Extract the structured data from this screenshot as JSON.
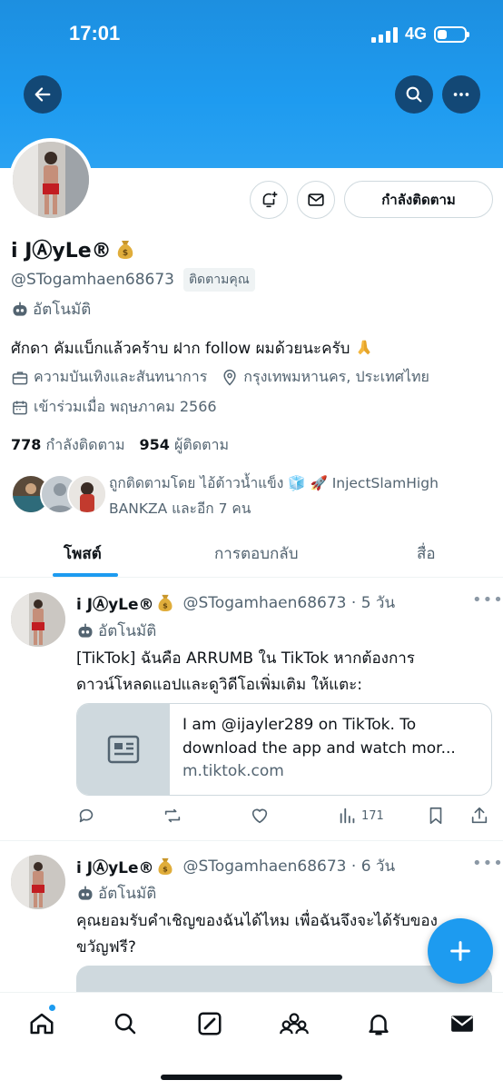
{
  "status_bar": {
    "time": "17:01",
    "network": "4G",
    "battery_level": 0.35
  },
  "colors": {
    "banner": "#1d9bf0",
    "accent": "#1d9bf0",
    "text": "#0f1419",
    "muted": "#536471"
  },
  "header": {
    "back_icon": "back-arrow-icon",
    "search_icon": "search-icon",
    "more_icon": "more-icon"
  },
  "profile": {
    "display_name": "i JⒶyLe®",
    "handle": "@STogamhaen68673",
    "follows_you_badge": "ติดตามคุณ",
    "automated_label": "อัตโนมัติ",
    "bio": "ศักดา คัมแบ็กแล้วคร้าบ ฝาก follow ผมด้วยนะครับ",
    "category": "ความบันเทิงและสันทนาการ",
    "location": "กรุงเทพมหานคร, ประเทศไทย",
    "joined": "เข้าร่วมเมื่อ พฤษภาคม 2566",
    "following_count": "778",
    "following_label": "กำลังติดตาม",
    "followers_count": "954",
    "followers_label": "ผู้ติดตาม",
    "followed_by_line1": "ถูกติดตามโดย ไอ้ต้าวน้ำแข็ง 🧊 🚀 InjectSlamHigh",
    "followed_by_line2": "BANKZA และอีก 7 คน"
  },
  "actions": {
    "following_button": "กำลังติดตาม"
  },
  "tabs": [
    {
      "label": "โพสต์",
      "active": true
    },
    {
      "label": "การตอบกลับ",
      "active": false
    },
    {
      "label": "สื่อ",
      "active": false
    }
  ],
  "tweets": [
    {
      "name": "i JⒶyLe®",
      "handle": "@STogamhaen68673",
      "time": "5 วัน",
      "automated": "อัตโนมัติ",
      "text_line1": "[TikTok] ฉันคือ ARRUMB ใน TikTok หากต้องการ",
      "text_line2": "ดาวน์โหลดแอปและดูวิดีโอเพิ่มเติม ให้แตะ:",
      "card_title_line1": "I am @ijayler289 on TikTok. To",
      "card_title_line2": "download the app and watch mor...",
      "card_domain": "m.tiktok.com",
      "views": "171"
    },
    {
      "name": "i JⒶyLe®",
      "handle": "@STogamhaen68673",
      "time": "6 วัน",
      "automated": "อัตโนมัติ",
      "text_line1": "คุณยอมรับคำเชิญของฉันได้ไหม เพื่อฉันจึงจะได้รับของ",
      "text_line2": "ขวัญฟรี?"
    }
  ],
  "nav": [
    "home-icon",
    "search-icon",
    "grok-icon",
    "communities-icon",
    "notifications-icon",
    "messages-icon"
  ]
}
